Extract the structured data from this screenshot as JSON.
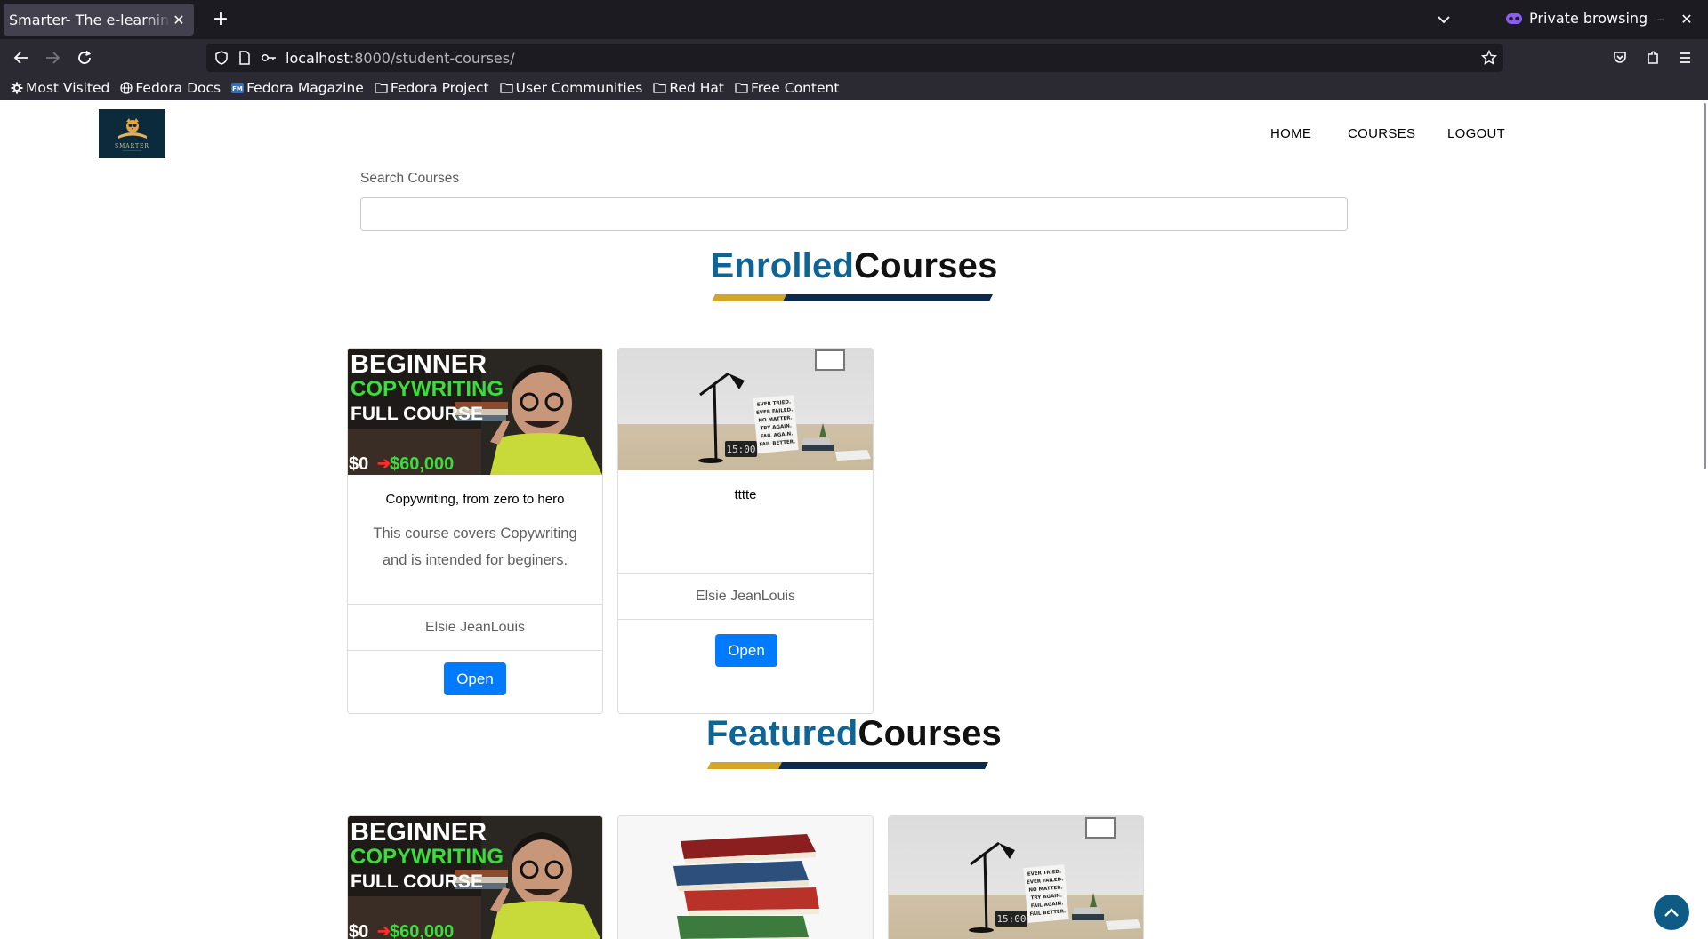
{
  "browser": {
    "tab_title": "Smarter- The e-learning",
    "tab_close": "✕",
    "new_tab": "+",
    "private_label": "Private browsing",
    "minimize": "–",
    "close": "✕",
    "url_host": "localhost",
    "url_rest": ":8000/student-courses/",
    "bookmarks": [
      {
        "label": "Most Visited",
        "icon": "gear-icon"
      },
      {
        "label": "Fedora Docs",
        "icon": "globe-icon"
      },
      {
        "label": "Fedora Magazine",
        "icon": "fm-icon"
      },
      {
        "label": "Fedora Project",
        "icon": "folder-icon"
      },
      {
        "label": "User Communities",
        "icon": "folder-icon"
      },
      {
        "label": "Red Hat",
        "icon": "folder-icon"
      },
      {
        "label": "Free Content",
        "icon": "folder-icon"
      }
    ]
  },
  "site": {
    "logo_text": "SMARTER",
    "nav": [
      "HOME",
      "COURSES",
      "LOGOUT"
    ],
    "search": {
      "label": "Search Courses",
      "value": "",
      "placeholder": ""
    },
    "enrolled": {
      "accent": "Enrolled",
      "rest": "Courses"
    },
    "featured": {
      "accent": "Featured",
      "rest": "Courses"
    },
    "colors": {
      "accent_blue": "#0e6493",
      "gold": "#d4a528",
      "navy": "#0d2a4a",
      "button": "#007bff"
    },
    "enrolled_courses": [
      {
        "title": "Copywriting, from zero to hero",
        "description": "This course covers Copywriting and is intended for beginers.",
        "author": "Elsie JeanLouis",
        "button": "Open",
        "thumbnail": "copywriting-thumbnail"
      },
      {
        "title": "tttte",
        "description": "",
        "author": "Elsie JeanLouis",
        "button": "Open",
        "thumbnail": "desk-lamp-thumbnail"
      }
    ],
    "featured_thumbnails": [
      "copywriting-thumbnail",
      "books-thumbnail",
      "desk-lamp-thumbnail"
    ],
    "thumb_text": {
      "line1": "BEGINNER",
      "line2": "COPYWRITING",
      "line3": "FULL COURSE",
      "price_from": "$0",
      "price_to": "$60,000",
      "sign": "EVER TRIED. EVER FAILED. NO MATTER. TRY AGAIN. FAIL AGAIN. FAIL BETTER.",
      "clock": "15:00"
    }
  }
}
